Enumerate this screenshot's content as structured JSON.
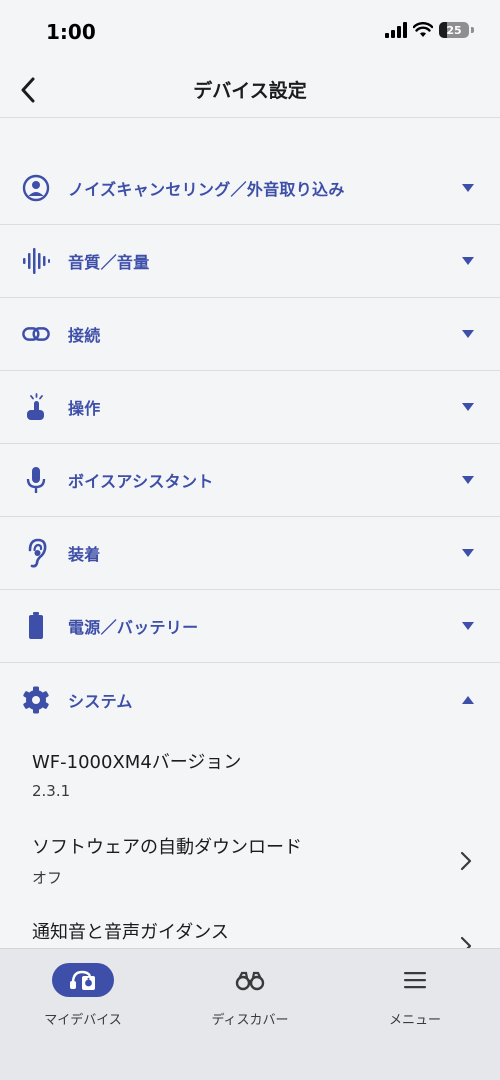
{
  "status_bar": {
    "time": "1:00",
    "battery": "25",
    "battery_fraction": 0.25
  },
  "header": {
    "title": "デバイス設定"
  },
  "sections": [
    {
      "label": "ノイズキャンセリング／外音取り込み",
      "icon": "person-noise-icon",
      "expanded": false
    },
    {
      "label": "音質／音量",
      "icon": "waveform-icon",
      "expanded": false
    },
    {
      "label": "接続",
      "icon": "link-icon",
      "expanded": false
    },
    {
      "label": "操作",
      "icon": "touch-icon",
      "expanded": false
    },
    {
      "label": "ボイスアシスタント",
      "icon": "microphone-icon",
      "expanded": false
    },
    {
      "label": "装着",
      "icon": "ear-icon",
      "expanded": false
    },
    {
      "label": "電源／バッテリー",
      "icon": "battery-icon",
      "expanded": false
    },
    {
      "label": "システム",
      "icon": "gear-icon",
      "expanded": true
    }
  ],
  "system_items": [
    {
      "title": "WF-1000XM4バージョン",
      "value": "2.3.1"
    },
    {
      "title": "ソフトウェアの自動ダウンロード",
      "value": "オフ"
    },
    {
      "title": "通知音と音声ガイダンス"
    }
  ],
  "tabs": [
    {
      "label": "マイデバイス",
      "icon": "headphones-icon",
      "active": true
    },
    {
      "label": "ディスカバー",
      "icon": "binoculars-icon",
      "active": false
    },
    {
      "label": "メニュー",
      "icon": "menu-icon",
      "active": false
    }
  ],
  "colors": {
    "accent": "#3d4fa8",
    "background": "#f4f5f7",
    "tab_bar": "#e6e7ea"
  }
}
